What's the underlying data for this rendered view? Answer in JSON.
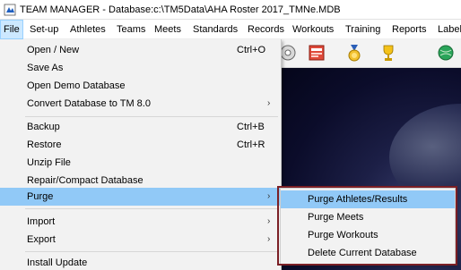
{
  "window": {
    "title": "TEAM MANAGER - Database:c:\\TM5Data\\AHA Roster 2017_TMNe.MDB"
  },
  "menubar": {
    "items": [
      "File",
      "Set-up",
      "Athletes",
      "Teams",
      "Meets",
      "Standards",
      "Records",
      "Workouts",
      "Training",
      "Reports",
      "Label"
    ]
  },
  "toolbar": {
    "icons": [
      "settings-icon",
      "report-icon",
      "medal-icon",
      "trophy-icon",
      "globe-icon"
    ]
  },
  "file_menu": {
    "items": [
      {
        "label": "Open / New",
        "shortcut": "Ctrl+O"
      },
      {
        "label": "Save As",
        "shortcut": ""
      },
      {
        "label": "Open Demo Database",
        "shortcut": ""
      },
      {
        "label": "Convert Database to TM 8.0",
        "shortcut": "",
        "submenu": true
      },
      {
        "label": "Backup",
        "shortcut": "Ctrl+B"
      },
      {
        "label": "Restore",
        "shortcut": "Ctrl+R"
      },
      {
        "label": "Unzip File",
        "shortcut": ""
      },
      {
        "label": "Repair/Compact Database",
        "shortcut": ""
      },
      {
        "label": "Purge",
        "shortcut": "",
        "submenu": true,
        "highlighted": true
      },
      {
        "label": "Import",
        "shortcut": "",
        "submenu": true
      },
      {
        "label": "Export",
        "shortcut": "",
        "submenu": true
      },
      {
        "label": "Install Update",
        "shortcut": ""
      }
    ],
    "submenu_arrow": "›"
  },
  "purge_submenu": {
    "items": [
      {
        "label": "Purge Athletes/Results",
        "highlighted": true
      },
      {
        "label": "Purge Meets"
      },
      {
        "label": "Purge Workouts"
      },
      {
        "label": "Delete Current Database"
      }
    ]
  },
  "colors": {
    "menu_hover": "#91c9f7",
    "menu_background": "#f2f2f2",
    "callout_border": "#7b1f25",
    "workspace_dark": "#0b0c2a"
  }
}
